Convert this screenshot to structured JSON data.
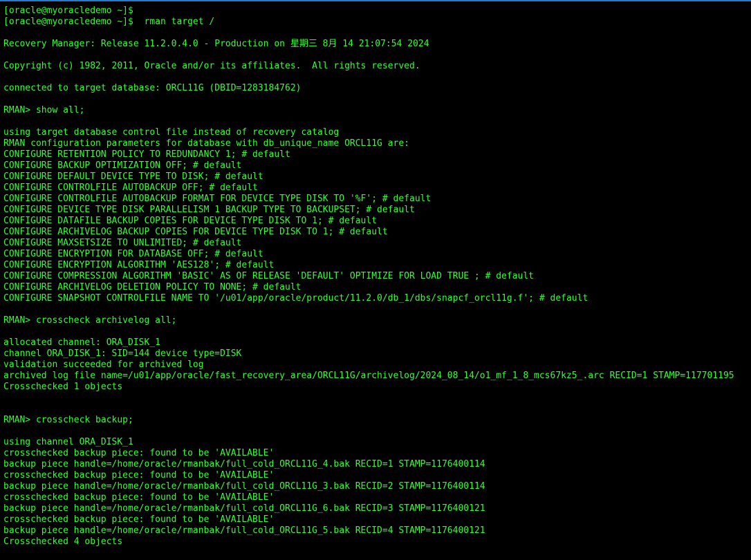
{
  "terminal": {
    "fg_color": "#33ff33",
    "bg_color": "#000000",
    "lines": [
      "[oracle@myoracledemo ~]$",
      "[oracle@myoracledemo ~]$  rman target /",
      "",
      "Recovery Manager: Release 11.2.0.4.0 - Production on 星期三 8月 14 21:07:54 2024",
      "",
      "Copyright (c) 1982, 2011, Oracle and/or its affiliates.  All rights reserved.",
      "",
      "connected to target database: ORCL11G (DBID=1283184762)",
      "",
      "RMAN> show all;",
      "",
      "using target database control file instead of recovery catalog",
      "RMAN configuration parameters for database with db_unique_name ORCL11G are:",
      "CONFIGURE RETENTION POLICY TO REDUNDANCY 1; # default",
      "CONFIGURE BACKUP OPTIMIZATION OFF; # default",
      "CONFIGURE DEFAULT DEVICE TYPE TO DISK; # default",
      "CONFIGURE CONTROLFILE AUTOBACKUP OFF; # default",
      "CONFIGURE CONTROLFILE AUTOBACKUP FORMAT FOR DEVICE TYPE DISK TO '%F'; # default",
      "CONFIGURE DEVICE TYPE DISK PARALLELISM 1 BACKUP TYPE TO BACKUPSET; # default",
      "CONFIGURE DATAFILE BACKUP COPIES FOR DEVICE TYPE DISK TO 1; # default",
      "CONFIGURE ARCHIVELOG BACKUP COPIES FOR DEVICE TYPE DISK TO 1; # default",
      "CONFIGURE MAXSETSIZE TO UNLIMITED; # default",
      "CONFIGURE ENCRYPTION FOR DATABASE OFF; # default",
      "CONFIGURE ENCRYPTION ALGORITHM 'AES128'; # default",
      "CONFIGURE COMPRESSION ALGORITHM 'BASIC' AS OF RELEASE 'DEFAULT' OPTIMIZE FOR LOAD TRUE ; # default",
      "CONFIGURE ARCHIVELOG DELETION POLICY TO NONE; # default",
      "CONFIGURE SNAPSHOT CONTROLFILE NAME TO '/u01/app/oracle/product/11.2.0/db_1/dbs/snapcf_orcl11g.f'; # default",
      "",
      "RMAN> crosscheck archivelog all;",
      "",
      "allocated channel: ORA_DISK_1",
      "channel ORA_DISK_1: SID=144 device type=DISK",
      "validation succeeded for archived log",
      "archived log file name=/u01/app/oracle/fast_recovery_area/ORCL11G/archivelog/2024_08_14/o1_mf_1_8_mcs67kz5_.arc RECID=1 STAMP=117701195",
      "Crosschecked 1 objects",
      "",
      "",
      "RMAN> crosscheck backup;",
      "",
      "using channel ORA_DISK_1",
      "crosschecked backup piece: found to be 'AVAILABLE'",
      "backup piece handle=/home/oracle/rmanbak/full_cold_ORCL11G_4.bak RECID=1 STAMP=1176400114",
      "crosschecked backup piece: found to be 'AVAILABLE'",
      "backup piece handle=/home/oracle/rmanbak/full_cold_ORCL11G_3.bak RECID=2 STAMP=1176400114",
      "crosschecked backup piece: found to be 'AVAILABLE'",
      "backup piece handle=/home/oracle/rmanbak/full_cold_ORCL11G_6.bak RECID=3 STAMP=1176400121",
      "crosschecked backup piece: found to be 'AVAILABLE'",
      "backup piece handle=/home/oracle/rmanbak/full_cold_ORCL11G_5.bak RECID=4 STAMP=1176400121",
      "Crosschecked 4 objects"
    ]
  }
}
